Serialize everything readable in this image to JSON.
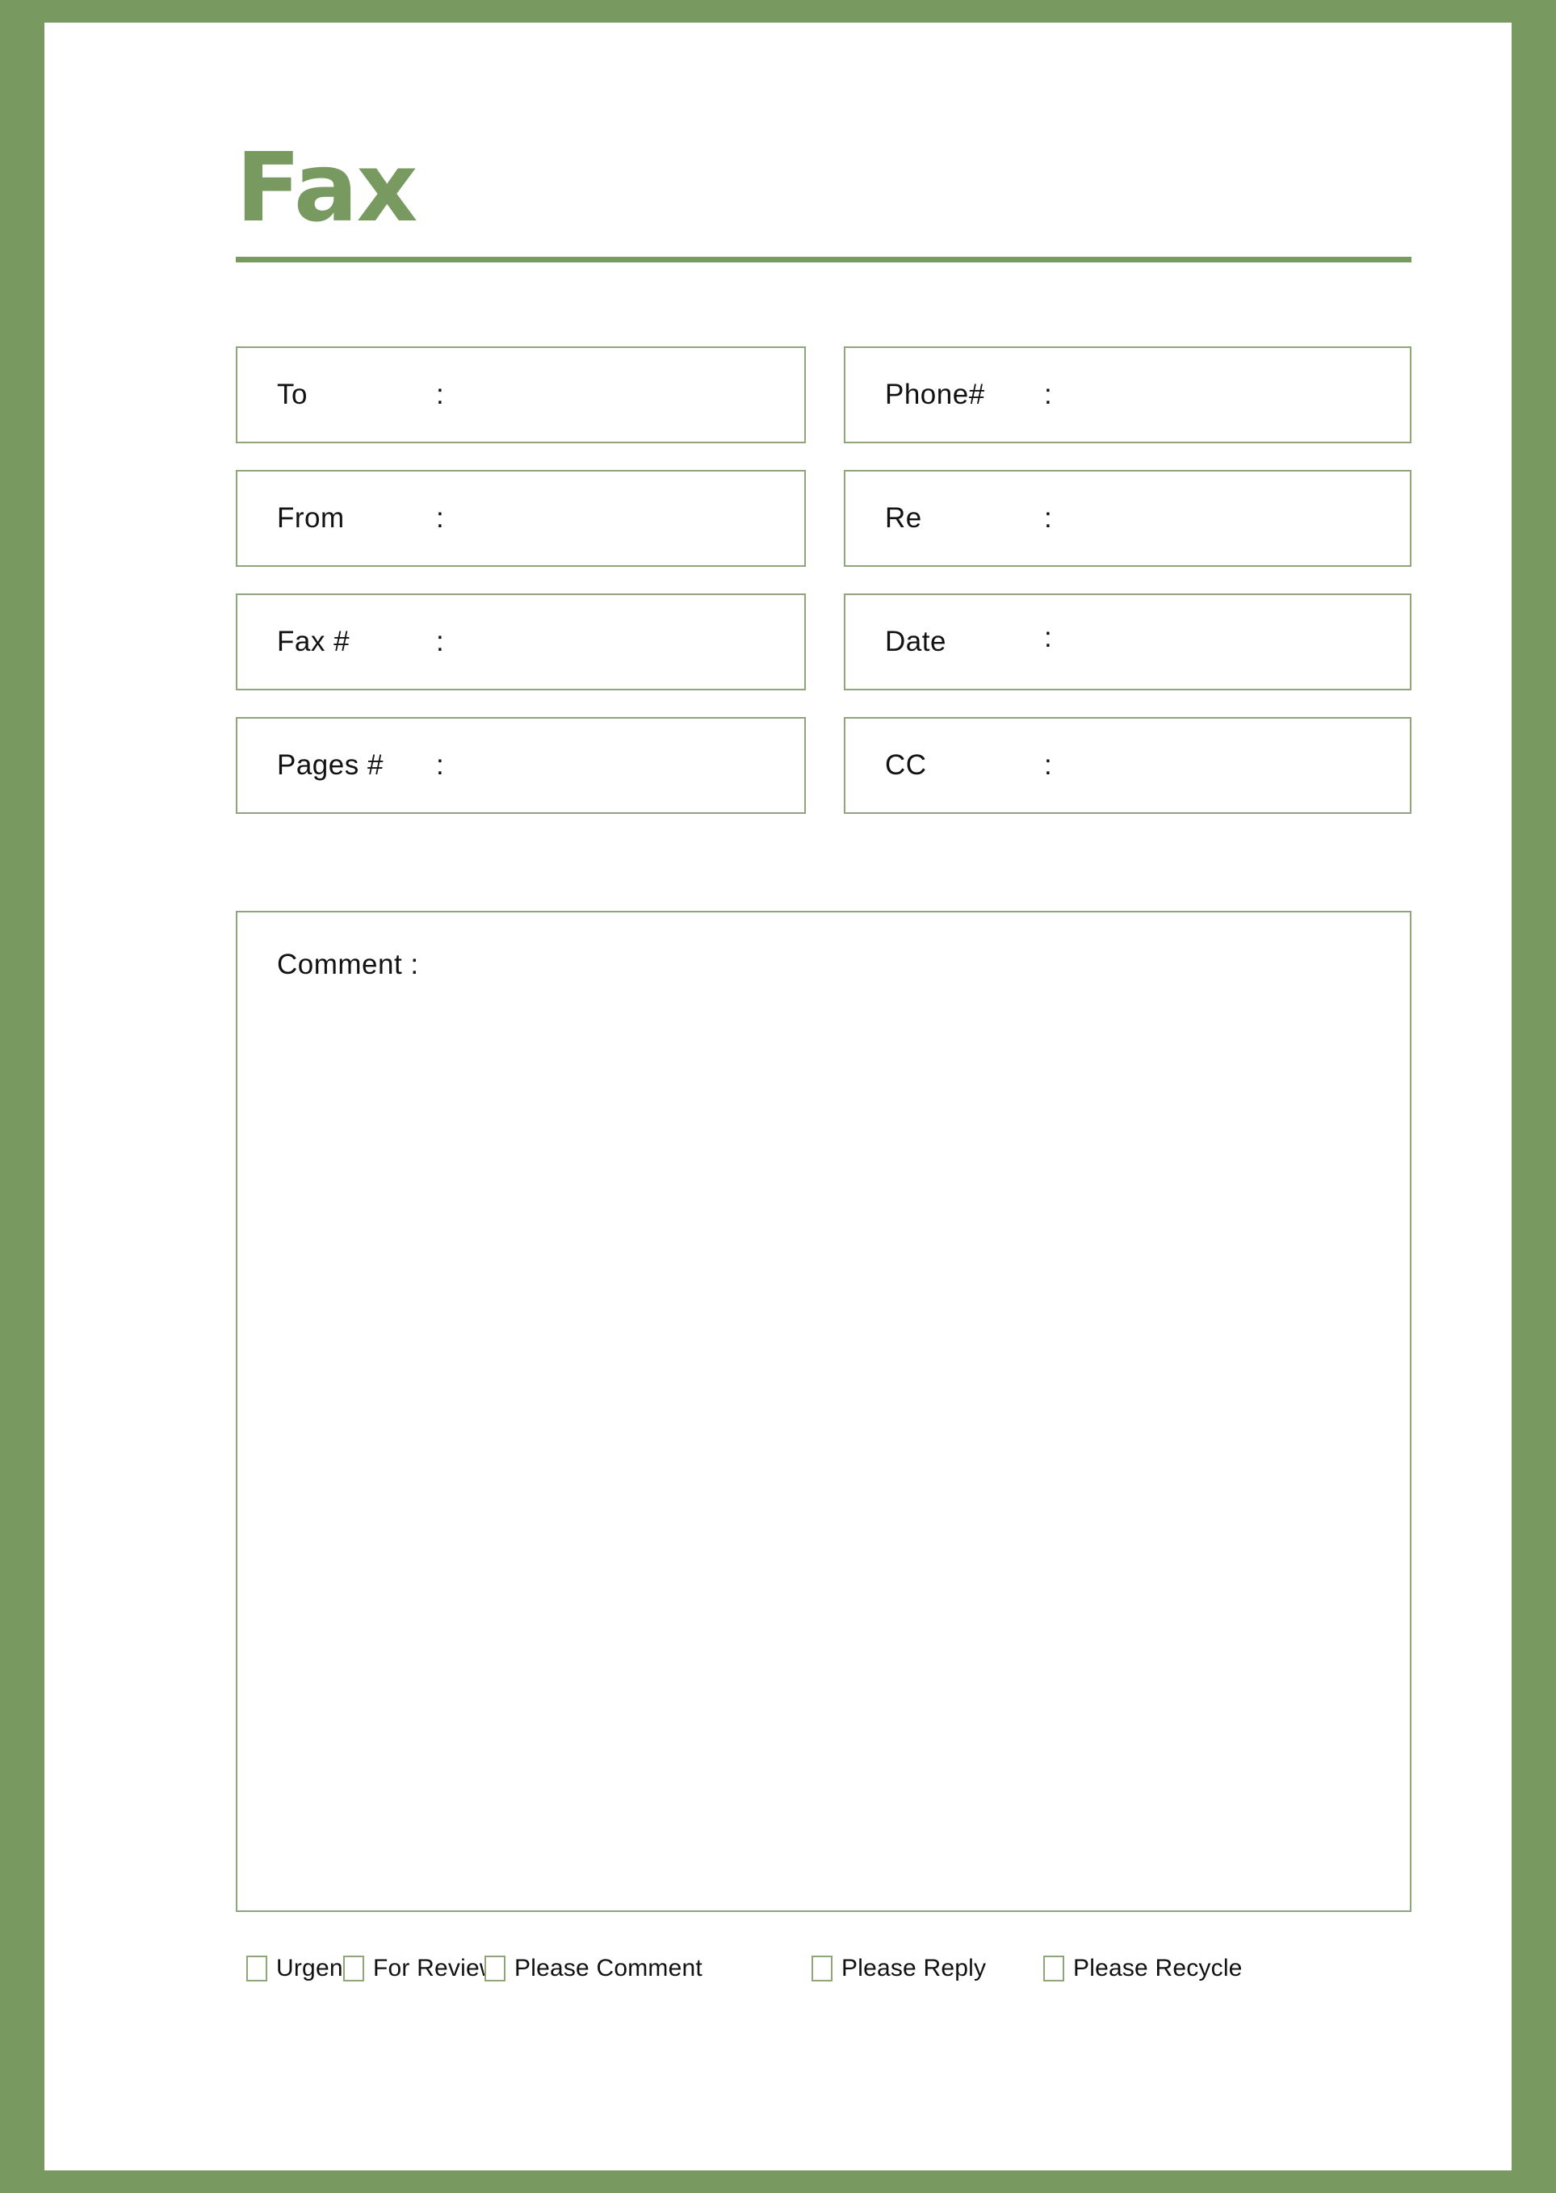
{
  "document": {
    "title": "Fax",
    "accent_color": "#789a60",
    "border_color": "#8fa67a",
    "text_color": "#121212"
  },
  "fields": {
    "colon": ":",
    "rows": [
      {
        "left": {
          "label": "To",
          "colon": ":"
        },
        "right": {
          "label": "Phone#",
          "colon": ":"
        }
      },
      {
        "left": {
          "label": "From",
          "colon": ":"
        },
        "right": {
          "label": "Re",
          "colon": ":"
        }
      },
      {
        "left": {
          "label": "Fax #",
          "colon": ":"
        },
        "right": {
          "label": "Date",
          "colon": ":"
        }
      },
      {
        "left": {
          "label": "Pages #",
          "colon": ":"
        },
        "right": {
          "label": "CC",
          "colon": ":"
        }
      }
    ]
  },
  "comment": {
    "label": "Comment :",
    "value": ""
  },
  "checkboxes": [
    {
      "label": "Urgent",
      "checked": false
    },
    {
      "label": "For Review",
      "checked": false
    },
    {
      "label": "Please Comment",
      "checked": false
    },
    {
      "label": "Please Reply",
      "checked": false
    },
    {
      "label": "Please Recycle",
      "checked": false
    }
  ]
}
